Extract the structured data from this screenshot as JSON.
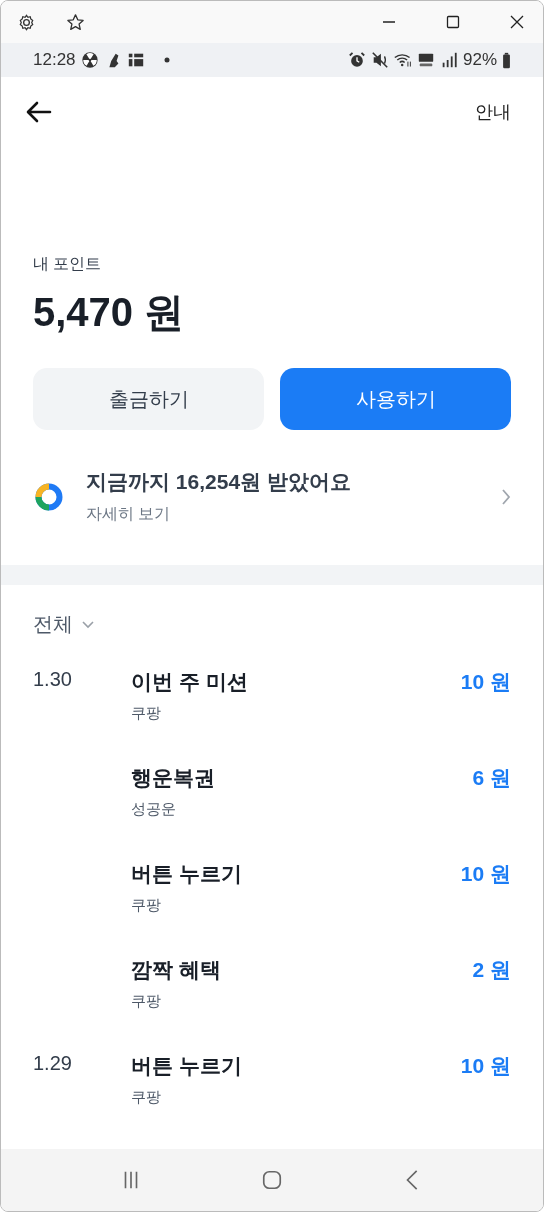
{
  "status_bar": {
    "time": "12:28",
    "battery": "92%"
  },
  "header": {
    "info_link": "안내"
  },
  "points": {
    "label": "내 포인트",
    "amount": "5,470 원"
  },
  "buttons": [
    {
      "label": "출금하기",
      "kind": "secondary"
    },
    {
      "label": "사용하기",
      "kind": "primary"
    }
  ],
  "summary": {
    "title": "지금까지 16,254원 받았어요",
    "subtitle": "자세히 보기"
  },
  "filter": {
    "label": "전체"
  },
  "history": [
    {
      "date": "1.30",
      "items": [
        {
          "title": "이번 주 미션",
          "source": "쿠팡",
          "amount": "10 원"
        },
        {
          "title": "행운복권",
          "source": "성공운",
          "amount": "6 원"
        },
        {
          "title": "버튼 누르기",
          "source": "쿠팡",
          "amount": "10 원"
        },
        {
          "title": "깜짝 혜택",
          "source": "쿠팡",
          "amount": "2 원"
        }
      ]
    },
    {
      "date": "1.29",
      "items": [
        {
          "title": "버튼 누르기",
          "source": "쿠팡",
          "amount": "10 원"
        }
      ]
    }
  ]
}
